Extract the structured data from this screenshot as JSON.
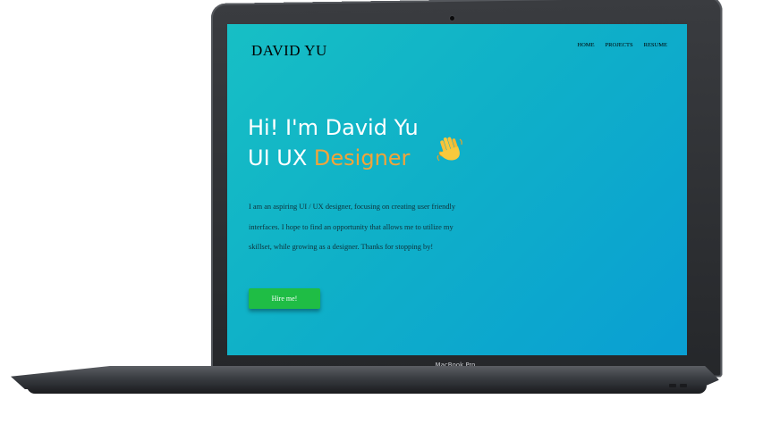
{
  "site": {
    "logo": "DAVID YU"
  },
  "nav": {
    "items": [
      "HOME",
      "PROJECTS",
      "RESUME"
    ]
  },
  "hero": {
    "line1": "Hi! I'm David Yu",
    "line2_prefix": "UI UX ",
    "line2_accent": "Designer",
    "emoji": "waving-hand-icon"
  },
  "intro": {
    "text": "I am an aspiring UI / UX designer, focusing on creating user friendly interfaces. I hope to find an opportunity that allows me to utilize my skillset, while growing as a designer. Thanks for stopping by!"
  },
  "cta": {
    "label": "Hire me!"
  },
  "device": {
    "label": "MacBook Pro"
  },
  "colors": {
    "screen_start": "#17bfc5",
    "screen_end": "#0a9fd3",
    "accent": "#f2a43a",
    "button": "#1fbd45"
  }
}
